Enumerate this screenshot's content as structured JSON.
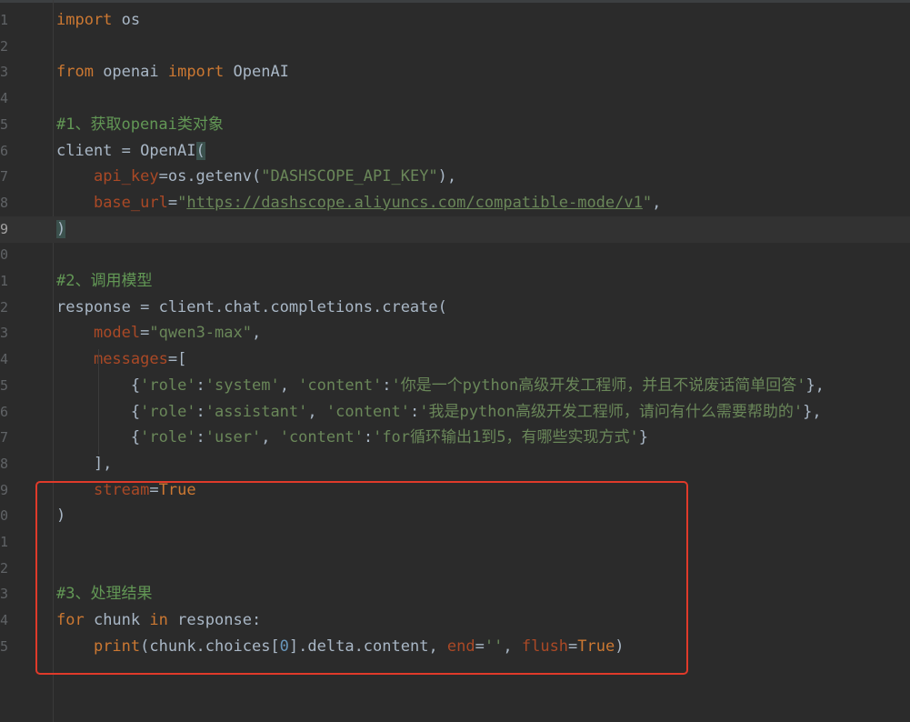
{
  "editor": {
    "language": "python",
    "current_line": 9,
    "annotation": {
      "type": "rectangle-highlight",
      "color": "#e03a2a",
      "lines": "19-25"
    },
    "lines": [
      {
        "n": "1",
        "tokens": [
          [
            "kw",
            "import"
          ],
          [
            "p",
            " os"
          ]
        ]
      },
      {
        "n": "2",
        "tokens": []
      },
      {
        "n": "3",
        "tokens": [
          [
            "kw",
            "from"
          ],
          [
            "p",
            " openai "
          ],
          [
            "kw",
            "import"
          ],
          [
            "p",
            " OpenAI"
          ]
        ]
      },
      {
        "n": "4",
        "tokens": []
      },
      {
        "n": "5",
        "tokens": [
          [
            "cm",
            "#1、获取openai类对象"
          ]
        ]
      },
      {
        "n": "6",
        "tokens": [
          [
            "p",
            "client = OpenAI"
          ],
          [
            "phl",
            "("
          ]
        ]
      },
      {
        "n": "7",
        "tokens": [
          [
            "p",
            "    "
          ],
          [
            "param",
            "api_key"
          ],
          [
            "p",
            "=os.getenv("
          ],
          [
            "str",
            "\"DASHSCOPE_API_KEY\""
          ],
          [
            "p",
            "),"
          ]
        ]
      },
      {
        "n": "8",
        "tokens": [
          [
            "p",
            "    "
          ],
          [
            "param",
            "base_url"
          ],
          [
            "p",
            "="
          ],
          [
            "str",
            "\""
          ],
          [
            "strlink",
            "https://dashscope.aliyuncs.com/compatible-mode/v1"
          ],
          [
            "str",
            "\""
          ],
          [
            "p",
            ","
          ]
        ]
      },
      {
        "n": "9",
        "tokens": [
          [
            "phl",
            ")"
          ]
        ]
      },
      {
        "n": "0",
        "tokens": []
      },
      {
        "n": "1",
        "tokens": [
          [
            "cm",
            "#2、调用模型"
          ]
        ]
      },
      {
        "n": "2",
        "tokens": [
          [
            "p",
            "response = client.chat.completions.create("
          ]
        ]
      },
      {
        "n": "3",
        "tokens": [
          [
            "p",
            "    "
          ],
          [
            "param",
            "model"
          ],
          [
            "p",
            "="
          ],
          [
            "str",
            "\"qwen3-max\""
          ],
          [
            "p",
            ","
          ]
        ]
      },
      {
        "n": "4",
        "tokens": [
          [
            "p",
            "    "
          ],
          [
            "param",
            "messages"
          ],
          [
            "p",
            "=["
          ]
        ]
      },
      {
        "n": "5",
        "tokens": [
          [
            "p",
            "        {"
          ],
          [
            "str",
            "'role'"
          ],
          [
            "p",
            ":"
          ],
          [
            "str",
            "'system'"
          ],
          [
            "p",
            ", "
          ],
          [
            "str",
            "'content'"
          ],
          [
            "p",
            ":"
          ],
          [
            "str",
            "'你是一个python高级开发工程师，并且不说废话简单回答'"
          ],
          [
            "p",
            "},"
          ]
        ]
      },
      {
        "n": "6",
        "tokens": [
          [
            "p",
            "        {"
          ],
          [
            "str",
            "'role'"
          ],
          [
            "p",
            ":"
          ],
          [
            "str",
            "'assistant'"
          ],
          [
            "p",
            ", "
          ],
          [
            "str",
            "'content'"
          ],
          [
            "p",
            ":"
          ],
          [
            "str",
            "'我是python高级开发工程师，请问有什么需要帮助的'"
          ],
          [
            "p",
            "},"
          ]
        ]
      },
      {
        "n": "7",
        "tokens": [
          [
            "p",
            "        {"
          ],
          [
            "str",
            "'role'"
          ],
          [
            "p",
            ":"
          ],
          [
            "str",
            "'user'"
          ],
          [
            "p",
            ", "
          ],
          [
            "str",
            "'content'"
          ],
          [
            "p",
            ":"
          ],
          [
            "str",
            "'for循环输出1到5，有哪些实现方式'"
          ],
          [
            "p",
            "}"
          ]
        ]
      },
      {
        "n": "8",
        "tokens": [
          [
            "p",
            "    ],"
          ]
        ]
      },
      {
        "n": "9",
        "tokens": [
          [
            "p",
            "    "
          ],
          [
            "param",
            "stream"
          ],
          [
            "p",
            "="
          ],
          [
            "kw",
            "True"
          ]
        ]
      },
      {
        "n": "0",
        "tokens": [
          [
            "p",
            ")"
          ]
        ]
      },
      {
        "n": "1",
        "tokens": []
      },
      {
        "n": "2",
        "tokens": []
      },
      {
        "n": "3",
        "tokens": [
          [
            "cm",
            "#3、处理结果"
          ]
        ]
      },
      {
        "n": "4",
        "tokens": [
          [
            "kw",
            "for"
          ],
          [
            "p",
            " chunk "
          ],
          [
            "kw",
            "in"
          ],
          [
            "p",
            " response:"
          ]
        ]
      },
      {
        "n": "5",
        "tokens": [
          [
            "p",
            "    "
          ],
          [
            "kw",
            "print"
          ],
          [
            "p",
            "(chunk.choices["
          ],
          [
            "num",
            "0"
          ],
          [
            "p",
            "].delta.content, "
          ],
          [
            "param",
            "end"
          ],
          [
            "p",
            "="
          ],
          [
            "str",
            "''"
          ],
          [
            "p",
            ", "
          ],
          [
            "param",
            "flush"
          ],
          [
            "p",
            "="
          ],
          [
            "kw",
            "True"
          ],
          [
            "p",
            ")"
          ]
        ]
      }
    ]
  }
}
